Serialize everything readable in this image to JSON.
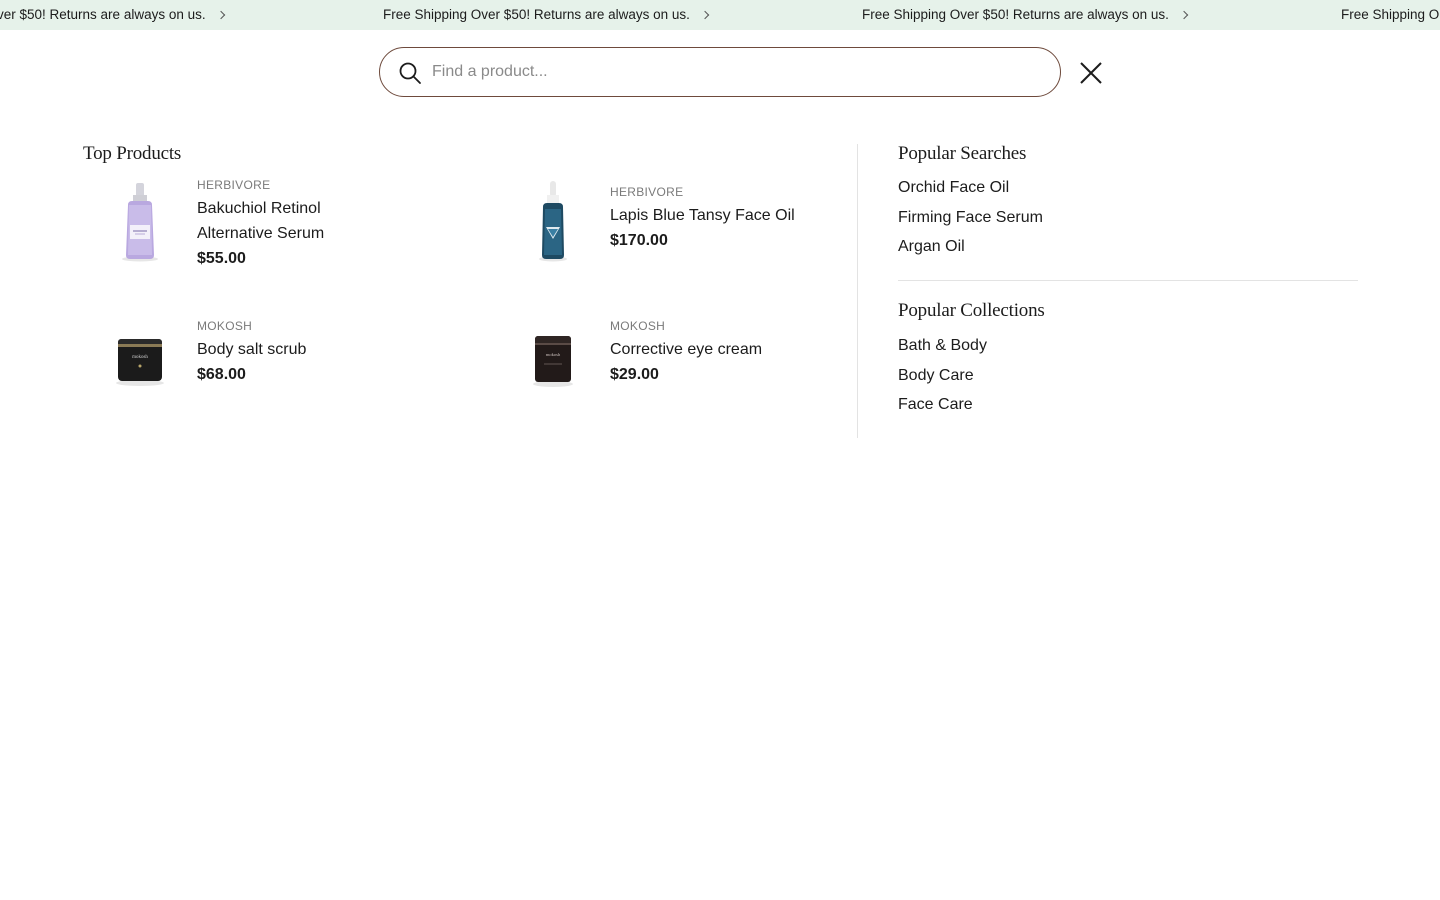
{
  "announcement": {
    "message": "Free Shipping Over $50! Returns are always on us.",
    "message_clipped_left": "ver $50! Returns are always on us.",
    "message_clipped_right": "Free Shipping O"
  },
  "search": {
    "placeholder": "Find a product...",
    "value": ""
  },
  "top_products": {
    "heading": "Top Products",
    "items": [
      {
        "brand": "HERBIVORE",
        "name_line1": "Bakuchiol Retinol",
        "name_line2": "Alternative Serum",
        "price": "$55.00",
        "image": "purple-serum-bottle"
      },
      {
        "brand": "HERBIVORE",
        "name_line1": "Lapis Blue Tansy Face Oil",
        "name_line2": "",
        "price": "$170.00",
        "image": "blue-dropper-bottle"
      },
      {
        "brand": "MOKOSH",
        "name_line1": "Body salt scrub",
        "name_line2": "",
        "price": "$68.00",
        "image": "dark-jar"
      },
      {
        "brand": "MOKOSH",
        "name_line1": "Corrective eye cream",
        "name_line2": "",
        "price": "$29.00",
        "image": "dark-jar"
      }
    ]
  },
  "popular_searches": {
    "heading": "Popular Searches",
    "items": [
      "Orchid Face Oil",
      "Firming Face Serum",
      "Argan Oil"
    ]
  },
  "popular_collections": {
    "heading": "Popular Collections",
    "items": [
      "Bath & Body",
      "Body Care",
      "Face Care"
    ]
  },
  "colors": {
    "announcement_bg": "#e6f2ea",
    "search_border": "#6e4a3c",
    "divider": "#e3e3e3"
  }
}
